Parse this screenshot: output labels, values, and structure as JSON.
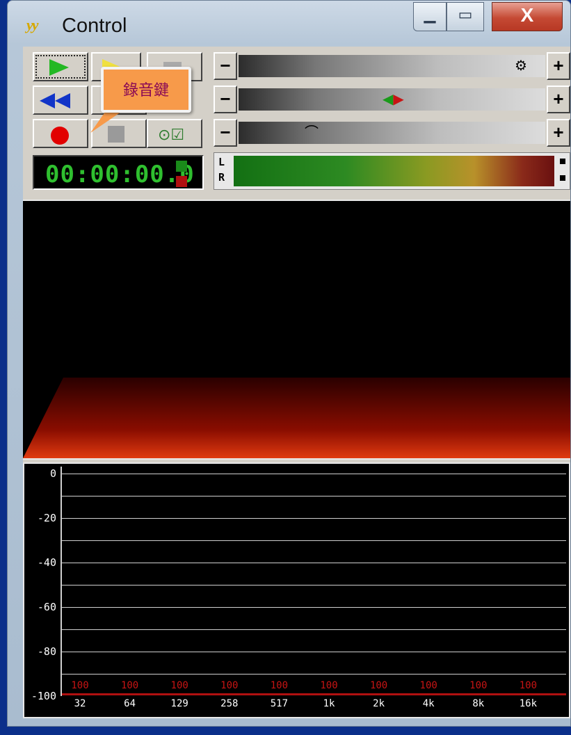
{
  "window": {
    "title": "Control",
    "app_icon": "yy-logo-icon"
  },
  "titlebar_buttons": {
    "minimize": "minimize-icon",
    "maximize": "maximize-icon",
    "close": "X"
  },
  "callout": {
    "text": "錄音鍵"
  },
  "time": {
    "display": "00:00:00.0"
  },
  "meter": {
    "left_label": "L",
    "right_label": "R"
  },
  "sliders": [
    {
      "minus": "−",
      "plus": "+",
      "thumb": "gear-icon",
      "level": 0.95
    },
    {
      "minus": "−",
      "plus": "+",
      "thumb": "balance-icon",
      "level": 0.5
    },
    {
      "minus": "−",
      "plus": "+",
      "thumb": "speed-icon",
      "level": 0.22
    }
  ],
  "eq": {
    "db_labels": [
      "0",
      "-20",
      "-40",
      "-60",
      "-80",
      "-100"
    ],
    "bands": [
      {
        "label": "32",
        "value": "100"
      },
      {
        "label": "64",
        "value": "100"
      },
      {
        "label": "129",
        "value": "100"
      },
      {
        "label": "258",
        "value": "100"
      },
      {
        "label": "517",
        "value": "100"
      },
      {
        "label": "1k",
        "value": "100"
      },
      {
        "label": "2k",
        "value": "100"
      },
      {
        "label": "4k",
        "value": "100"
      },
      {
        "label": "8k",
        "value": "100"
      },
      {
        "label": "16k",
        "value": "100"
      }
    ]
  },
  "colors": {
    "time_green": "#2fbf2f",
    "record_red": "#e20000",
    "eq_value_red": "#c81414",
    "callout_orange": "#f79a4a"
  }
}
